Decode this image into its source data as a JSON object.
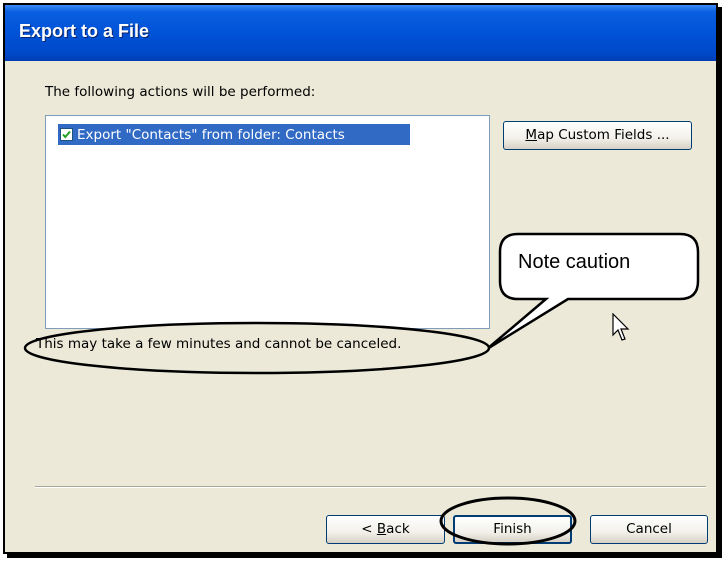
{
  "window": {
    "title": "Export to a File"
  },
  "intro_text": "The following actions will be performed:",
  "actions_list": {
    "items": [
      {
        "label": "Export \"Contacts\" from folder: Contacts",
        "checked": true
      }
    ]
  },
  "map_fields_button": {
    "label_underlined": "M",
    "label_rest": "ap Custom Fields ..."
  },
  "note_callout": "Note caution",
  "caution_text": "This may take a few minutes and cannot be canceled.",
  "buttons": {
    "back": {
      "prefix": "< ",
      "underlined": "B",
      "rest": "ack"
    },
    "finish": "Finish",
    "cancel": "Cancel"
  },
  "colors": {
    "titlebar": "#0052d6",
    "dialog_bg": "#ece9d8",
    "selection": "#316ac5"
  }
}
